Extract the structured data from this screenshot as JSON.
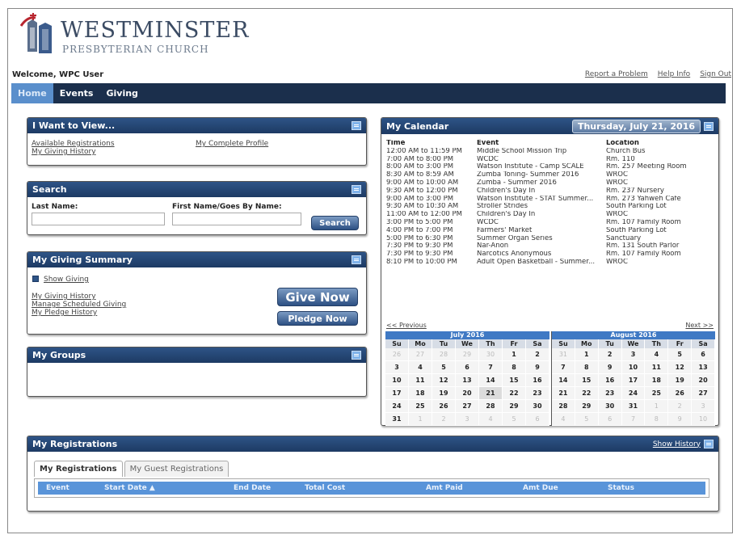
{
  "header": {
    "brand_title": "WESTMINSTER",
    "brand_subtitle": "PRESBYTERIAN CHURCH",
    "welcome": "Welcome, WPC User",
    "links": [
      "Report a Problem",
      "Help Info",
      "Sign Out"
    ]
  },
  "nav": {
    "tabs": [
      "Home",
      "Events",
      "Giving"
    ],
    "active": "Home"
  },
  "want_to_view": {
    "title": "I Want to View...",
    "links_left": [
      "Available Registrations",
      "My Giving History"
    ],
    "link_right": "My Complete Profile"
  },
  "search": {
    "title": "Search",
    "last_name_label": "Last Name:",
    "first_name_label": "First Name/Goes By Name:",
    "button": "Search",
    "last_name_value": "",
    "first_name_value": ""
  },
  "giving_summary": {
    "title": "My Giving Summary",
    "show_giving": "Show Giving",
    "links": [
      "My Giving History",
      "Manage Scheduled Giving",
      "My Pledge History"
    ],
    "give_now": "Give Now",
    "pledge_now": "Pledge Now"
  },
  "groups": {
    "title": "My Groups"
  },
  "calendar": {
    "title": "My Calendar",
    "date": "Thursday, July 21, 2016",
    "columns": [
      "Time",
      "Event",
      "Location"
    ],
    "events": [
      [
        "12:00 AM to 11:59 PM",
        "Middle School Mission Trip",
        "Church Bus"
      ],
      [
        "7:00 AM to 8:00 PM",
        "WCDC",
        "Rm. 110"
      ],
      [
        "8:00 AM to 3:00 PM",
        "Watson Institute - Camp SCALE",
        "Rm. 257 Meeting Room"
      ],
      [
        "8:30 AM to 8:59 AM",
        "Zumba Toning- Summer 2016",
        "WROC"
      ],
      [
        "9:00 AM to 10:00 AM",
        "Zumba - Summer 2016",
        "WROC"
      ],
      [
        "9:30 AM to 12:00 PM",
        "Children's Day In",
        "Rm. 237 Nursery"
      ],
      [
        "9:00 AM to 3:00 PM",
        "Watson Institute - STAT Summer...",
        "Rm. 273 Yahweh Cafe"
      ],
      [
        "9:30 AM to 10:30 AM",
        "Stroller Strides",
        "South Parking Lot"
      ],
      [
        "11:00 AM to 12:00 PM",
        "Children's Day In",
        "WROC"
      ],
      [
        "3:00 PM to 5:00 PM",
        "WCDC",
        "Rm. 107 Family Room"
      ],
      [
        "4:00 PM to 7:00 PM",
        "Farmers' Market",
        "South Parking Lot"
      ],
      [
        "5:00 PM to 6:30 PM",
        "Summer Organ Series",
        "Sanctuary"
      ],
      [
        "7:30 PM to 9:30 PM",
        "Nar-Anon",
        "Rm. 131 South Parlor"
      ],
      [
        "7:30 PM to 9:30 PM",
        "Narcotics Anonymous",
        "Rm. 107 Family Room"
      ],
      [
        "8:10 PM to 10:00 PM",
        "Adult Open Basketball - Summer...",
        "WROC"
      ]
    ],
    "prev": "<< Previous",
    "next": "Next >>",
    "months": [
      {
        "name": "July 2016",
        "dow": [
          "Su",
          "Mo",
          "Tu",
          "We",
          "Th",
          "Fr",
          "Sa"
        ],
        "weeks": [
          [
            [
              "26",
              1
            ],
            [
              "27",
              1
            ],
            [
              "28",
              1
            ],
            [
              "29",
              1
            ],
            [
              "30",
              1
            ],
            [
              "1",
              0
            ],
            [
              "2",
              0
            ]
          ],
          [
            [
              "3",
              0
            ],
            [
              "4",
              0
            ],
            [
              "5",
              0
            ],
            [
              "6",
              0
            ],
            [
              "7",
              0
            ],
            [
              "8",
              0
            ],
            [
              "9",
              0
            ]
          ],
          [
            [
              "10",
              0
            ],
            [
              "11",
              0
            ],
            [
              "12",
              0
            ],
            [
              "13",
              0
            ],
            [
              "14",
              0
            ],
            [
              "15",
              0
            ],
            [
              "16",
              0
            ]
          ],
          [
            [
              "17",
              0
            ],
            [
              "18",
              0
            ],
            [
              "19",
              0
            ],
            [
              "20",
              0
            ],
            [
              "21",
              2
            ],
            [
              "22",
              0
            ],
            [
              "23",
              0
            ]
          ],
          [
            [
              "24",
              0
            ],
            [
              "25",
              0
            ],
            [
              "26",
              0
            ],
            [
              "27",
              0
            ],
            [
              "28",
              0
            ],
            [
              "29",
              0
            ],
            [
              "30",
              0
            ]
          ],
          [
            [
              "31",
              0
            ],
            [
              "1",
              1
            ],
            [
              "2",
              1
            ],
            [
              "3",
              1
            ],
            [
              "4",
              1
            ],
            [
              "5",
              1
            ],
            [
              "6",
              1
            ]
          ]
        ]
      },
      {
        "name": "August 2016",
        "dow": [
          "Su",
          "Mo",
          "Tu",
          "We",
          "Th",
          "Fr",
          "Sa"
        ],
        "weeks": [
          [
            [
              "31",
              1
            ],
            [
              "1",
              0
            ],
            [
              "2",
              0
            ],
            [
              "3",
              0
            ],
            [
              "4",
              0
            ],
            [
              "5",
              0
            ],
            [
              "6",
              0
            ]
          ],
          [
            [
              "7",
              0
            ],
            [
              "8",
              0
            ],
            [
              "9",
              0
            ],
            [
              "10",
              0
            ],
            [
              "11",
              0
            ],
            [
              "12",
              0
            ],
            [
              "13",
              0
            ]
          ],
          [
            [
              "14",
              0
            ],
            [
              "15",
              0
            ],
            [
              "16",
              0
            ],
            [
              "17",
              0
            ],
            [
              "18",
              0
            ],
            [
              "19",
              0
            ],
            [
              "20",
              0
            ]
          ],
          [
            [
              "21",
              0
            ],
            [
              "22",
              0
            ],
            [
              "23",
              0
            ],
            [
              "24",
              0
            ],
            [
              "25",
              0
            ],
            [
              "26",
              0
            ],
            [
              "27",
              0
            ]
          ],
          [
            [
              "28",
              0
            ],
            [
              "29",
              0
            ],
            [
              "30",
              0
            ],
            [
              "31",
              0
            ],
            [
              "1",
              1
            ],
            [
              "2",
              1
            ],
            [
              "3",
              1
            ]
          ],
          [
            [
              "4",
              1
            ],
            [
              "5",
              1
            ],
            [
              "6",
              1
            ],
            [
              "7",
              1
            ],
            [
              "8",
              1
            ],
            [
              "9",
              1
            ],
            [
              "10",
              1
            ]
          ]
        ]
      }
    ]
  },
  "registrations": {
    "title": "My Registrations",
    "show_history": "Show History",
    "tabs": [
      "My Registrations",
      "My Guest Registrations"
    ],
    "columns": [
      "Event",
      "Start Date ▲",
      "End Date",
      "Total Cost",
      "Amt Paid",
      "Amt Due",
      "Status"
    ]
  },
  "colors": {
    "nav_bg": "#1b2f4c",
    "panel_head": "#2e5487",
    "active_tab": "#5a8fcc",
    "table_head": "#5994d9"
  }
}
